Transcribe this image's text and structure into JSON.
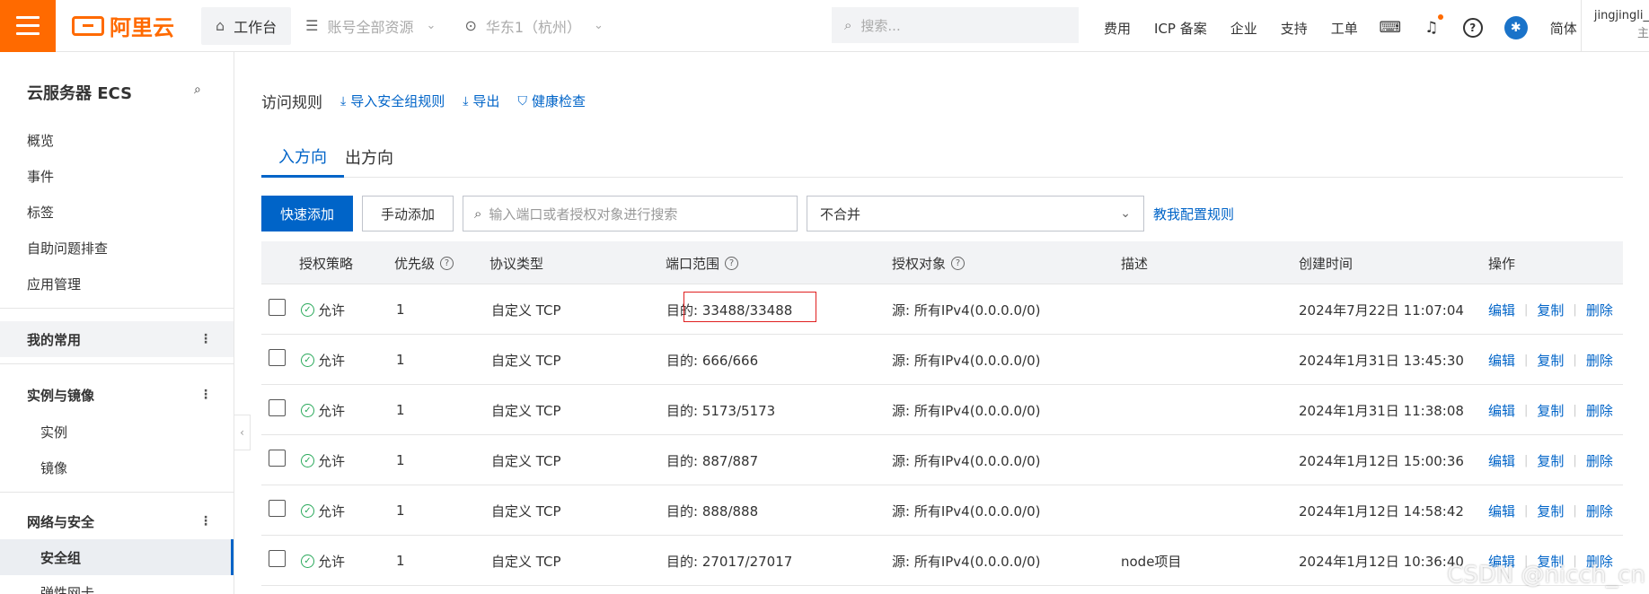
{
  "topbar": {
    "logo_text": "阿里云",
    "workbench": "工作台",
    "resources": "账号全部资源",
    "region": "华东1（杭州）",
    "search_placeholder": "搜索...",
    "links": [
      "费用",
      "ICP 备案",
      "企业",
      "支持",
      "工单"
    ],
    "lang": "简体",
    "username": "jingjingli_",
    "role": "主"
  },
  "sidebar": {
    "title": "云服务器 ECS",
    "top_items": [
      "概览",
      "事件",
      "标签",
      "自助问题排查",
      "应用管理"
    ],
    "group_favorites": "我的常用",
    "group_instances": "实例与镜像",
    "instances_sub": [
      "实例",
      "镜像"
    ],
    "group_network": "网络与安全",
    "selected": "安全组",
    "next_item": "弹性网卡"
  },
  "header": {
    "title": "访问规则",
    "import": "导入安全组规则",
    "export": "导出",
    "health": "健康检查"
  },
  "tabs": [
    "入方向",
    "出方向"
  ],
  "toolbar": {
    "quick_add": "快速添加",
    "manual_add": "手动添加",
    "search_placeholder": "输入端口或者授权对象进行搜索",
    "merge_select": "不合并",
    "help_link": "教我配置规则"
  },
  "table": {
    "headers": [
      "授权策略",
      "优先级",
      "协议类型",
      "端口范围",
      "授权对象",
      "描述",
      "创建时间",
      "操作"
    ],
    "ops": [
      "编辑",
      "复制",
      "删除"
    ],
    "rows": [
      {
        "policy": "允许",
        "priority": "1",
        "protocol": "自定义 TCP",
        "port": "目的: 33488/33488",
        "source": "源: 所有IPv4(0.0.0.0/0)",
        "desc": "",
        "created": "2024年7月22日 11:07:04"
      },
      {
        "policy": "允许",
        "priority": "1",
        "protocol": "自定义 TCP",
        "port": "目的: 666/666",
        "source": "源: 所有IPv4(0.0.0.0/0)",
        "desc": "",
        "created": "2024年1月31日 13:45:30"
      },
      {
        "policy": "允许",
        "priority": "1",
        "protocol": "自定义 TCP",
        "port": "目的: 5173/5173",
        "source": "源: 所有IPv4(0.0.0.0/0)",
        "desc": "",
        "created": "2024年1月31日 11:38:08"
      },
      {
        "policy": "允许",
        "priority": "1",
        "protocol": "自定义 TCP",
        "port": "目的: 887/887",
        "source": "源: 所有IPv4(0.0.0.0/0)",
        "desc": "",
        "created": "2024年1月12日 15:00:36"
      },
      {
        "policy": "允许",
        "priority": "1",
        "protocol": "自定义 TCP",
        "port": "目的: 888/888",
        "source": "源: 所有IPv4(0.0.0.0/0)",
        "desc": "",
        "created": "2024年1月12日 14:58:42"
      },
      {
        "policy": "允许",
        "priority": "1",
        "protocol": "自定义 TCP",
        "port": "目的: 27017/27017",
        "source": "源: 所有IPv4(0.0.0.0/0)",
        "desc": "node项目",
        "created": "2024年1月12日 10:36:40"
      }
    ]
  },
  "watermark": "CSDN @nicch_cn"
}
